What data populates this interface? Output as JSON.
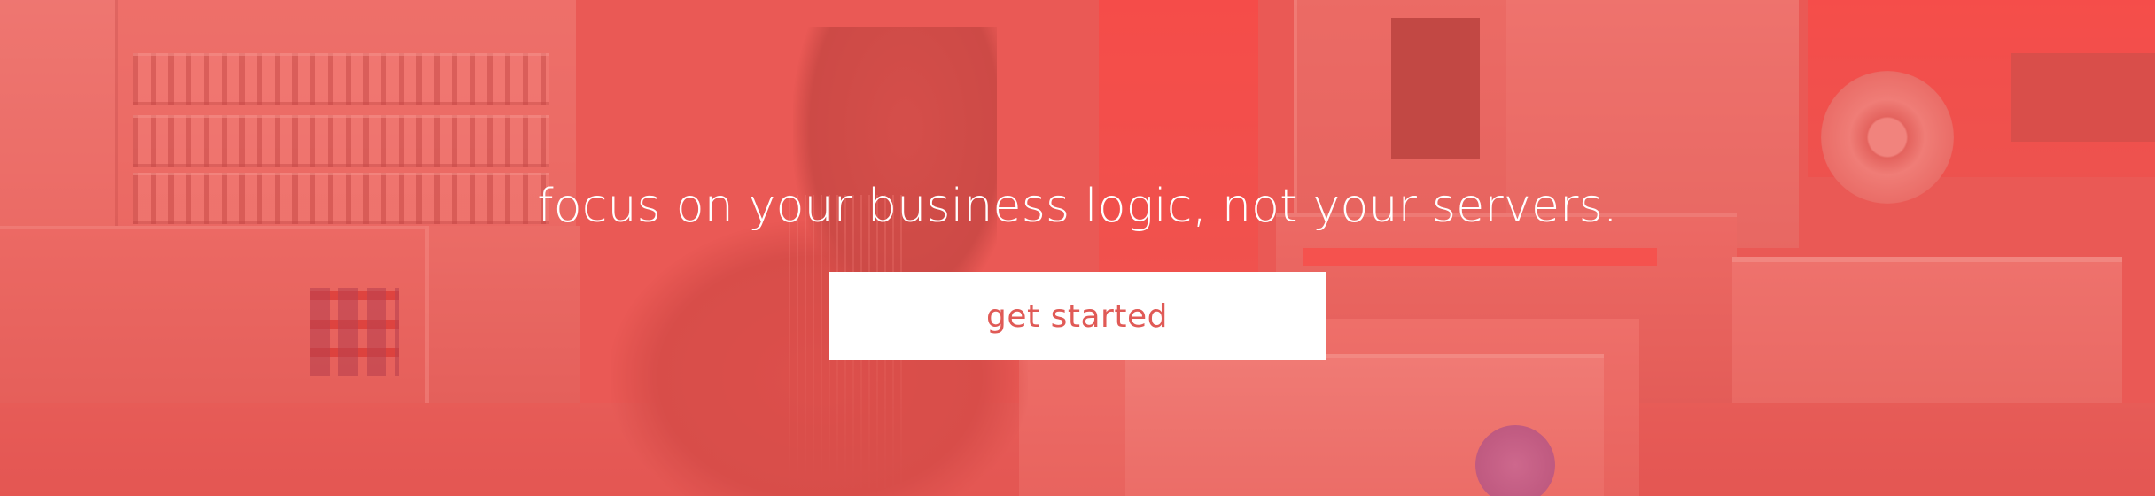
{
  "hero": {
    "headline": "focus on your business logic, not your servers.",
    "cta_label": "get started"
  },
  "colors": {
    "overlay": "#e65954",
    "cta_background": "#ffffff",
    "cta_text": "#e05a56",
    "headline_text": "#ffffff"
  }
}
